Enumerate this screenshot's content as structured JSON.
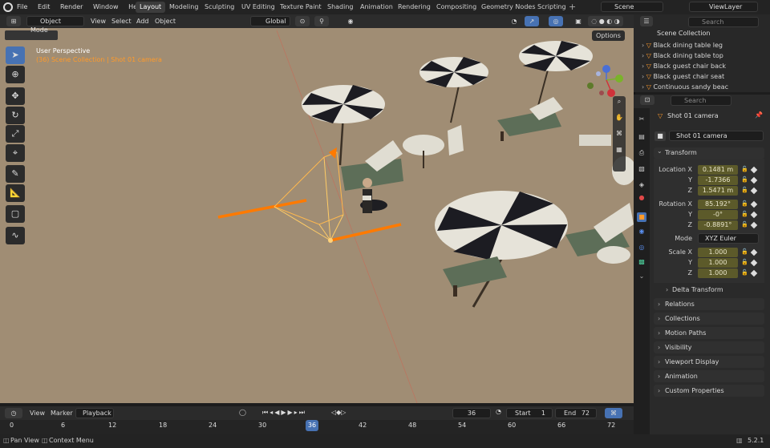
{
  "topbar": {
    "menus": [
      "File",
      "Edit",
      "Render",
      "Window",
      "Help"
    ],
    "workspaces": [
      "Layout",
      "Modeling",
      "Sculpting",
      "UV Editing",
      "Texture Paint",
      "Shading",
      "Animation",
      "Rendering",
      "Compositing",
      "Geometry Nodes",
      "Scripting"
    ],
    "scene": "Scene",
    "view_layer": "ViewLayer"
  },
  "viewport": {
    "mode": "Object Mode",
    "menus": [
      "View",
      "Select",
      "Add",
      "Object"
    ],
    "orientation": "Global",
    "options": "Options",
    "info_title": "User Perspective",
    "info_sub": "(36) Scene Collection | Shot 01 camera"
  },
  "outliner": {
    "search_placeholder": "Search",
    "root": "Scene Collection",
    "items": [
      "Black dining table leg",
      "Black dining table top",
      "Black guest chair back",
      "Black guest chair seat",
      "Continuous sandy beac"
    ]
  },
  "properties": {
    "search_placeholder": "Search",
    "object_name": "Shot 01 camera",
    "data_name": "Shot 01 camera",
    "transform_label": "Transform",
    "location_label": "Location X",
    "rotation_label": "Rotation X",
    "mode_label": "Mode",
    "mode_value": "XYZ Euler",
    "scale_label": "Scale X",
    "axis_y": "Y",
    "axis_z": "Z",
    "location": [
      "0.1481 m",
      "-1.7366",
      "1.5471 m"
    ],
    "rotation": [
      "85.192°",
      "-0°",
      "-0.8891°"
    ],
    "scale": [
      "1.000",
      "1.000",
      "1.000"
    ],
    "sections": [
      "Delta Transform",
      "Relations",
      "Collections",
      "Motion Paths",
      "Visibility",
      "Viewport Display",
      "Animation",
      "Custom Properties"
    ]
  },
  "timeline": {
    "menus": [
      "View",
      "Marker",
      "Playback"
    ],
    "current": "36",
    "start_label": "Start",
    "start": "1",
    "end_label": "End",
    "end": "72",
    "ticks": [
      "0",
      "6",
      "12",
      "18",
      "24",
      "30",
      "36",
      "42",
      "48",
      "54",
      "60",
      "66",
      "72"
    ]
  },
  "status": {
    "left": "Pan View",
    "context": "Context Menu",
    "version": "5.2.1"
  },
  "colors": {
    "accent": "#4772b3",
    "selection": "#ff7a00",
    "ground": "#a08d74"
  }
}
